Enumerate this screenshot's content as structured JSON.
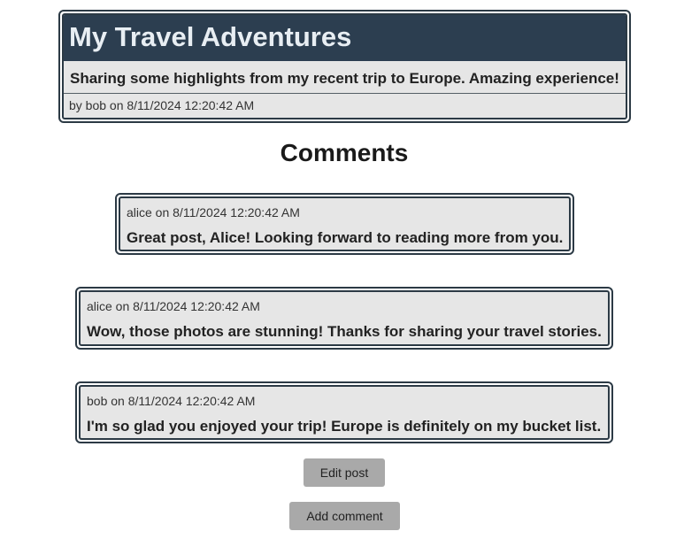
{
  "post": {
    "title": "My Travel Adventures",
    "body": "Sharing some highlights from my recent trip to Europe. Amazing experience!",
    "meta": "by bob on 8/11/2024 12:20:42 AM"
  },
  "comments_heading": "Comments",
  "comments": [
    {
      "meta": "alice on 8/11/2024 12:20:42 AM",
      "text": "Great post, Alice! Looking forward to reading more from you."
    },
    {
      "meta": "alice on 8/11/2024 12:20:42 AM",
      "text": "Wow, those photos are stunning! Thanks for sharing your travel stories."
    },
    {
      "meta": "bob on 8/11/2024 12:20:42 AM",
      "text": "I'm so glad you enjoyed your trip! Europe is definitely on my bucket list."
    }
  ],
  "actions": {
    "edit_label": "Edit post",
    "add_comment_label": "Add comment"
  },
  "colors": {
    "title_bar": "#2c3e50",
    "card_background": "#e6e6e6",
    "card_border": "#2c3a45",
    "button_background": "#a9a9a9"
  }
}
